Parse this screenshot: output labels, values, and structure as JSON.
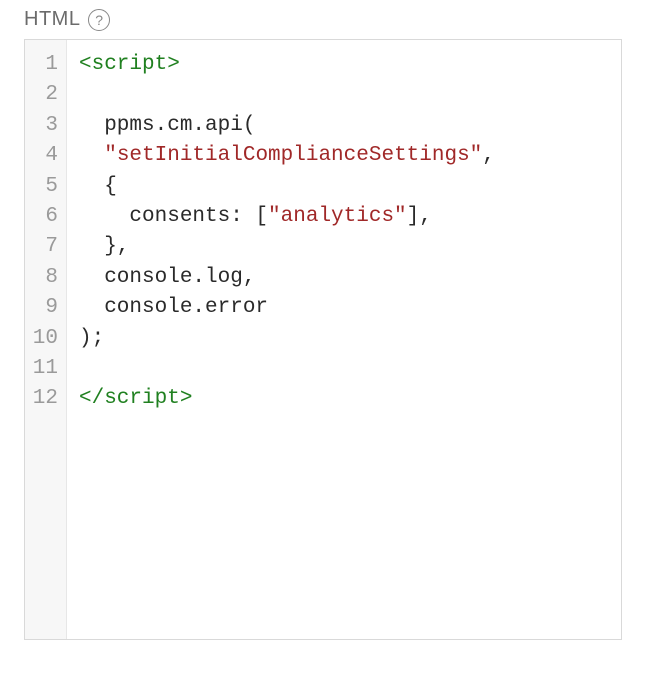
{
  "header": {
    "label": "HTML",
    "help_tooltip": "?"
  },
  "editor": {
    "line_numbers": [
      "1",
      "2",
      "3",
      "4",
      "5",
      "6",
      "7",
      "8",
      "9",
      "10",
      "11",
      "12"
    ],
    "lines": [
      {
        "tokens": [
          {
            "kind": "tag",
            "text": "<script>"
          }
        ]
      },
      {
        "tokens": []
      },
      {
        "tokens": [
          {
            "kind": "plain",
            "text": "  ppms.cm.api("
          }
        ]
      },
      {
        "tokens": [
          {
            "kind": "plain",
            "text": "  "
          },
          {
            "kind": "string",
            "text": "\"setInitialComplianceSettings\""
          },
          {
            "kind": "plain",
            "text": ","
          }
        ]
      },
      {
        "tokens": [
          {
            "kind": "plain",
            "text": "  {"
          }
        ]
      },
      {
        "tokens": [
          {
            "kind": "plain",
            "text": "    consents: ["
          },
          {
            "kind": "string",
            "text": "\"analytics\""
          },
          {
            "kind": "plain",
            "text": "],"
          }
        ]
      },
      {
        "tokens": [
          {
            "kind": "plain",
            "text": "  },"
          }
        ]
      },
      {
        "tokens": [
          {
            "kind": "plain",
            "text": "  console.log,"
          }
        ]
      },
      {
        "tokens": [
          {
            "kind": "plain",
            "text": "  console.error"
          }
        ]
      },
      {
        "tokens": [
          {
            "kind": "plain",
            "text": ");"
          }
        ]
      },
      {
        "tokens": []
      },
      {
        "tokens": [
          {
            "kind": "tag",
            "text": "</scr"
          },
          {
            "kind": "tag",
            "text": "ipt>"
          }
        ]
      }
    ]
  }
}
